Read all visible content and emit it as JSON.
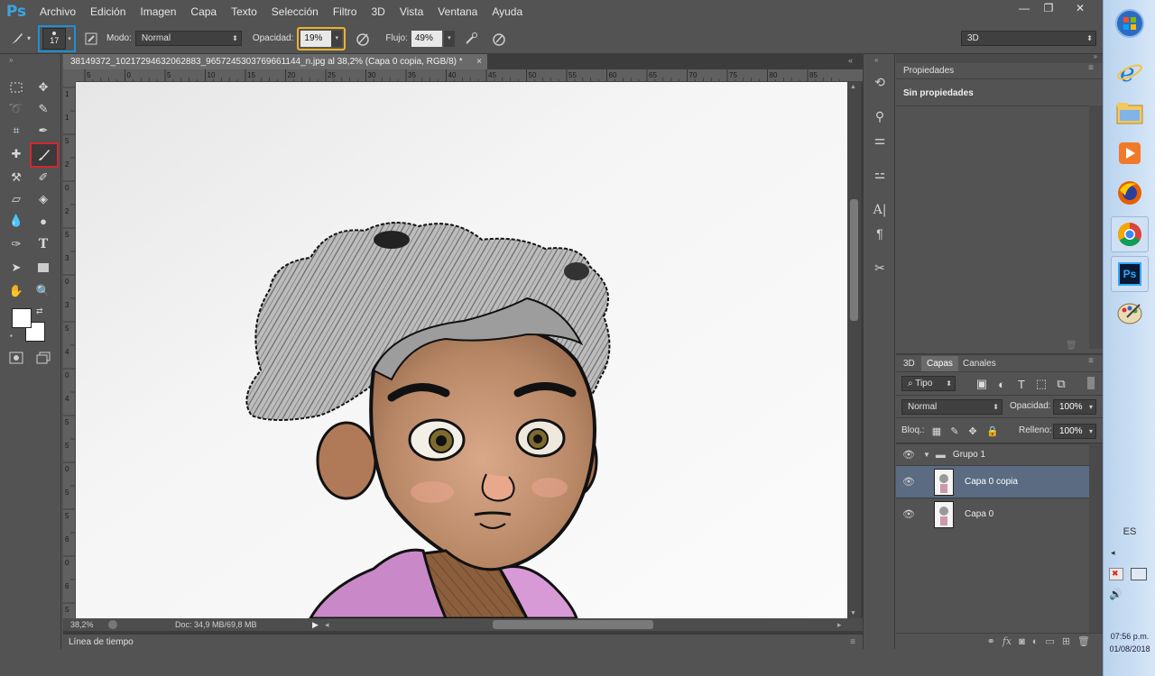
{
  "menubar": {
    "logo": "Ps",
    "items": [
      "Archivo",
      "Edición",
      "Imagen",
      "Capa",
      "Texto",
      "Selección",
      "Filtro",
      "3D",
      "Vista",
      "Ventana",
      "Ayuda"
    ],
    "window_controls": {
      "minimize": "—",
      "restore": "❐",
      "close": "✕"
    }
  },
  "options": {
    "brush_size": "17",
    "mode_label": "Modo:",
    "mode_value": "Normal",
    "opacity_label": "Opacidad:",
    "opacity_value": "19%",
    "flow_label": "Flujo:",
    "flow_value": "49%",
    "workspace": "3D"
  },
  "document": {
    "tab_title": "38149372_10217294632062883_9657245303769661144_n.jpg al 38,2% (Capa 0 copia, RGB/8) *",
    "tab_close": "×",
    "ruler_h_labels": [
      "5",
      "0",
      "5",
      "10",
      "15",
      "20",
      "25",
      "30",
      "35",
      "40",
      "45",
      "50",
      "55",
      "60",
      "65",
      "70",
      "75",
      "80",
      "85"
    ],
    "ruler_v_labels": [
      "1",
      "1",
      "5",
      "2",
      "0",
      "2",
      "5",
      "3",
      "0",
      "3",
      "5",
      "4",
      "0",
      "4",
      "5",
      "5",
      "0",
      "5",
      "5",
      "6",
      "0",
      "6",
      "5"
    ],
    "zoom": "38,2%",
    "doc_info": "Doc: 34,9 MB/69,8 MB"
  },
  "timeline": {
    "label": "Línea de tiempo"
  },
  "properties": {
    "tab": "Propiedades",
    "content": "Sin propiedades"
  },
  "layers_panel": {
    "tabs": [
      "3D",
      "Capas",
      "Canales"
    ],
    "filter_kind": "Tipo",
    "blend_mode": "Normal",
    "opacity_label": "Opacidad:",
    "opacity_value": "100%",
    "lock_label": "Bloq.:",
    "fill_label": "Relleno:",
    "fill_value": "100%",
    "layers": [
      {
        "name": "Grupo 1",
        "type": "group",
        "selected": false
      },
      {
        "name": "Capa 0 copia",
        "type": "layer",
        "selected": true
      },
      {
        "name": "Capa 0",
        "type": "layer",
        "selected": false
      }
    ]
  },
  "taskbar": {
    "language": "ES",
    "time": "07:56 p.m.",
    "date": "01/08/2018",
    "ps_label": "Ps"
  },
  "colors": {
    "highlight_blue": "#1e8fd6",
    "highlight_red": "#d4272e",
    "highlight_yellow": "#f0b12a",
    "selected_layer": "#5a6b82"
  }
}
